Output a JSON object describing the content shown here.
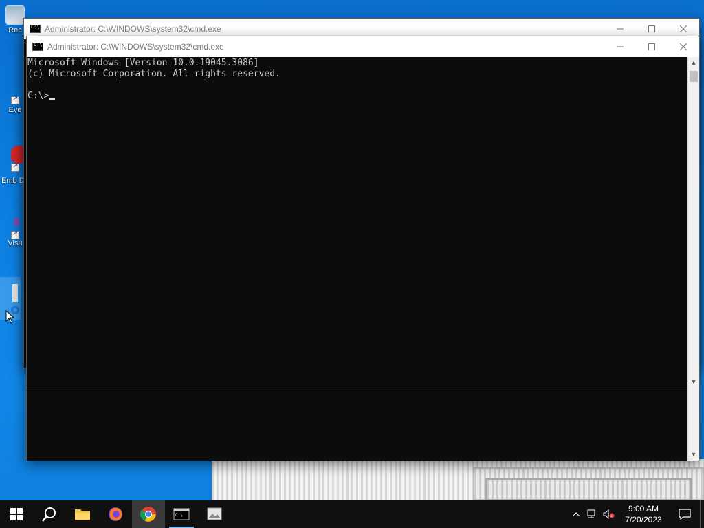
{
  "desktop": {
    "icons": [
      {
        "label": "Rec",
        "name": "recycle-bin"
      },
      {
        "label": "Eve",
        "name": "event-viewer"
      },
      {
        "label": "Emb De",
        "name": "embedded-dev"
      },
      {
        "label": "Visu",
        "name": "visual-studio"
      }
    ]
  },
  "windows": {
    "back": {
      "title": "Administrator: C:\\WINDOWS\\system32\\cmd.exe"
    },
    "front": {
      "title": "Administrator: C:\\WINDOWS\\system32\\cmd.exe",
      "console_lines": [
        "Microsoft Windows [Version 10.0.19045.3086]",
        "(c) Microsoft Corporation. All rights reserved.",
        "",
        "C:\\>"
      ]
    }
  },
  "taskbar": {
    "apps": [
      {
        "name": "start-button",
        "icon": "windows-logo-icon"
      },
      {
        "name": "search-button",
        "icon": "search-icon"
      },
      {
        "name": "file-explorer-button",
        "icon": "folder-icon"
      },
      {
        "name": "firefox-button",
        "icon": "firefox-icon"
      },
      {
        "name": "chrome-button",
        "icon": "chrome-icon",
        "active": true
      },
      {
        "name": "cmd-button",
        "icon": "terminal-icon",
        "running": true
      },
      {
        "name": "image-viewer-button",
        "icon": "image-icon"
      }
    ],
    "clock": {
      "time": "9:00 AM",
      "date": "7/20/2023"
    }
  },
  "colors": {
    "console_bg": "#0c0c0c",
    "console_text": "#cccccc",
    "desktop_blue": "#0c7fe0",
    "taskbar_bg": "#101010",
    "chrome_active_bg": "#3a3a3a"
  }
}
